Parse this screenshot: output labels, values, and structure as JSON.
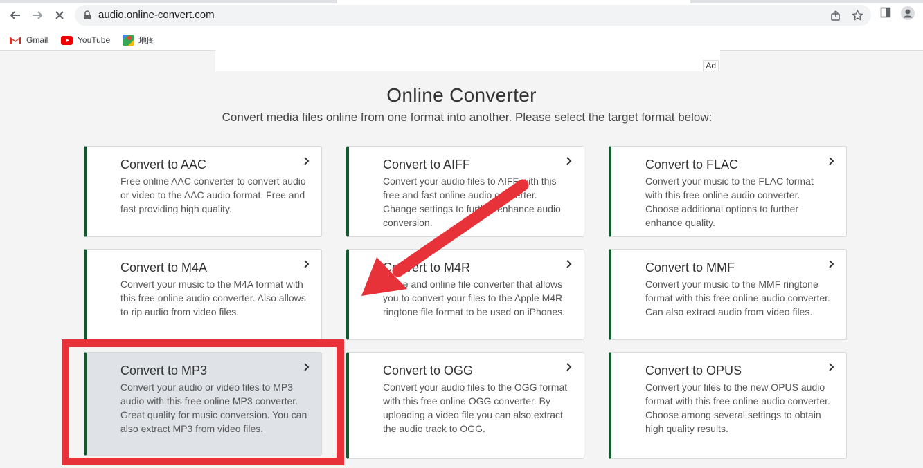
{
  "browser": {
    "url": "audio.online-convert.com",
    "bookmarks": [
      {
        "label": "Gmail",
        "icon": "gmail-icon"
      },
      {
        "label": "YouTube",
        "icon": "youtube-icon"
      },
      {
        "label": "地图",
        "icon": "maps-icon"
      }
    ]
  },
  "ad": {
    "label": "Ad"
  },
  "page": {
    "title": "Online Converter",
    "subtitle": "Convert media files online from one format into another. Please select the target format below:"
  },
  "cards": [
    {
      "title": "Convert to AAC",
      "desc": "Free online AAC converter to convert audio or video to the AAC audio format. Free and fast providing high quality."
    },
    {
      "title": "Convert to AIFF",
      "desc": "Convert your audio files to AIFF with this free and fast online audio converter. Change settings to further enhance audio conversion."
    },
    {
      "title": "Convert to FLAC",
      "desc": "Convert your music to the FLAC format with this free online audio converter. Choose additional options to further enhance quality."
    },
    {
      "title": "Convert to M4A",
      "desc": "Convert your music to the M4A format with this free online audio converter. Also allows to rip audio from video files."
    },
    {
      "title": "Convert to M4R",
      "desc": "A free and online file converter that allows you to convert your files to the Apple M4R ringtone file format to be used on iPhones."
    },
    {
      "title": "Convert to MMF",
      "desc": "Convert your music to the MMF ringtone format with this free online audio converter. Can also extract audio from video files."
    },
    {
      "title": "Convert to MP3",
      "desc": "Convert your audio or video files to MP3 audio with this free online MP3 converter. Great quality for music conversion. You can also extract MP3 from video files."
    },
    {
      "title": "Convert to OGG",
      "desc": "Convert your audio files to the OGG format with this free online OGG converter. By uploading a video file you can also extract the audio track to OGG."
    },
    {
      "title": "Convert to OPUS",
      "desc": "Convert your files to the new OPUS audio format with this free online audio converter. Choose among several settings to obtain high quality results."
    }
  ],
  "colors": {
    "accent": "#0f5a2a",
    "highlight": "#e8323a",
    "selected_card": "#dfe3e8"
  }
}
